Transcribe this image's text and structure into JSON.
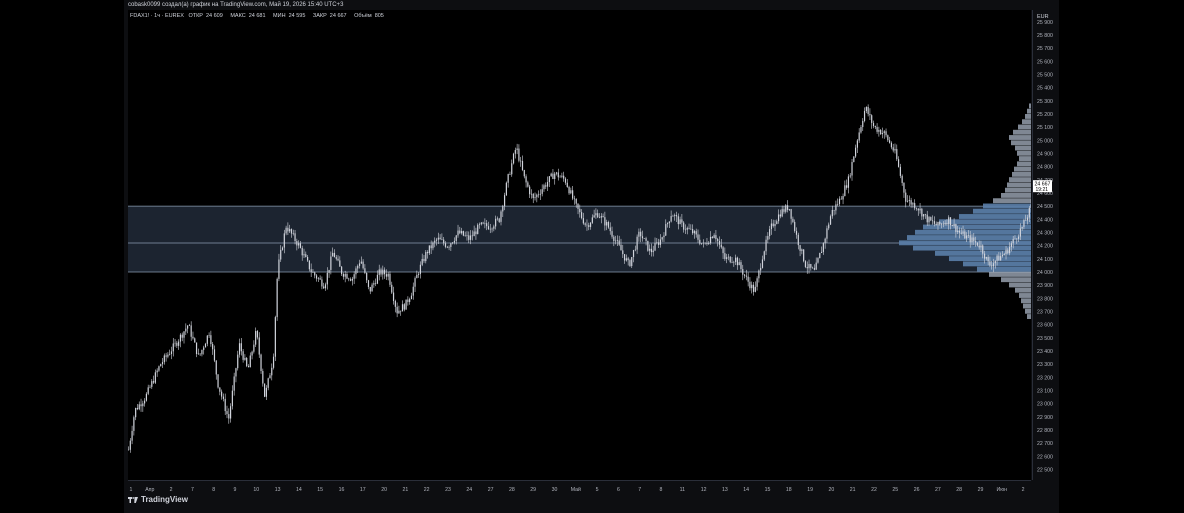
{
  "header": {
    "caption": "cobask0099 создал(а) график на TradingView.com, Май 19, 2026 15:40 UTC+3"
  },
  "legend": {
    "symbol": "FDAX1! · 1ч · EUREX",
    "open_label": "ОТКР",
    "open_value": "24 609",
    "high_label": "МАКС",
    "high_value": "24 681",
    "low_label": "МИН",
    "low_value": "24 595",
    "close_label": "ЗАКР",
    "close_value": "24 667",
    "volume_label": "Объём",
    "volume_value": "805"
  },
  "footer": {
    "brand": "TradingView"
  },
  "colors": {
    "candle": "#d1d4dc",
    "zone_fill": "#1c2430",
    "zone_line": "#8a9bb0",
    "profile": "#5b7faa",
    "profile_light": "#a9b4c4",
    "price_tag_bg": "#ffffff",
    "price_tag_text": "#000000"
  },
  "chart_data": {
    "type": "candlestick",
    "currency": "EUR",
    "y_ticks": [
      "25 900",
      "25 800",
      "25 700",
      "25 600",
      "25 500",
      "25 400",
      "25 300",
      "25 200",
      "25 100",
      "25 000",
      "24 900",
      "24 800",
      "24 700",
      "24 600",
      "24 500",
      "24 400",
      "24 300",
      "24 200",
      "24 100",
      "24 000",
      "23 900",
      "23 800",
      "23 700",
      "23 600",
      "23 500",
      "23 400",
      "23 300",
      "23 200",
      "23 100",
      "23 000",
      "22 900",
      "22 800",
      "22 700",
      "22 600",
      "22 500"
    ],
    "ylim": [
      22420,
      25990
    ],
    "x_ticks": [
      "1",
      "Апр",
      "2",
      "7",
      "8",
      "9",
      "10",
      "13",
      "14",
      "15",
      "16",
      "17",
      "20",
      "21",
      "22",
      "23",
      "24",
      "27",
      "28",
      "29",
      "30",
      "Май",
      "5",
      "6",
      "7",
      "8",
      "11",
      "12",
      "13",
      "14",
      "15",
      "18",
      "19",
      "20",
      "21",
      "22",
      "25",
      "26",
      "27",
      "28",
      "29",
      "Июн",
      "2"
    ],
    "price_tag": {
      "value": "24 667",
      "countdown": "19:21"
    },
    "value_area": {
      "high": 24500,
      "poc": 24220,
      "low": 24000
    },
    "price_path": [
      [
        0,
        22650
      ],
      [
        0.3,
        22950
      ],
      [
        0.8,
        23050
      ],
      [
        1.5,
        23300
      ],
      [
        2.2,
        23450
      ],
      [
        2.8,
        23600
      ],
      [
        3.3,
        23350
      ],
      [
        3.8,
        23550
      ],
      [
        4.2,
        23150
      ],
      [
        4.7,
        22880
      ],
      [
        5.2,
        23450
      ],
      [
        5.6,
        23250
      ],
      [
        6.0,
        23550
      ],
      [
        6.4,
        23050
      ],
      [
        6.8,
        23350
      ],
      [
        7.0,
        24020
      ],
      [
        7.4,
        24350
      ],
      [
        8.0,
        24200
      ],
      [
        8.6,
        24000
      ],
      [
        9.2,
        23900
      ],
      [
        9.6,
        24150
      ],
      [
        10.0,
        24000
      ],
      [
        10.5,
        23950
      ],
      [
        10.9,
        24100
      ],
      [
        11.3,
        23850
      ],
      [
        11.8,
        24000
      ],
      [
        12.2,
        23980
      ],
      [
        12.6,
        23700
      ],
      [
        13.0,
        23750
      ],
      [
        13.3,
        23850
      ],
      [
        13.6,
        24000
      ],
      [
        14.0,
        24150
      ],
      [
        14.5,
        24250
      ],
      [
        15.0,
        24200
      ],
      [
        15.5,
        24300
      ],
      [
        16.0,
        24250
      ],
      [
        16.5,
        24350
      ],
      [
        17.0,
        24350
      ],
      [
        17.4,
        24400
      ],
      [
        17.8,
        24700
      ],
      [
        18.2,
        24950
      ],
      [
        18.6,
        24700
      ],
      [
        19.0,
        24550
      ],
      [
        19.5,
        24650
      ],
      [
        20.0,
        24750
      ],
      [
        20.5,
        24700
      ],
      [
        21.0,
        24500
      ],
      [
        21.5,
        24350
      ],
      [
        22.0,
        24450
      ],
      [
        22.5,
        24350
      ],
      [
        23.0,
        24200
      ],
      [
        23.5,
        24050
      ],
      [
        24.0,
        24300
      ],
      [
        24.5,
        24150
      ],
      [
        25.0,
        24250
      ],
      [
        25.5,
        24450
      ],
      [
        26.0,
        24350
      ],
      [
        26.5,
        24300
      ],
      [
        27.0,
        24200
      ],
      [
        27.5,
        24300
      ],
      [
        28.0,
        24100
      ],
      [
        28.5,
        24100
      ],
      [
        29.0,
        23950
      ],
      [
        29.4,
        23850
      ],
      [
        29.8,
        24150
      ],
      [
        30.2,
        24350
      ],
      [
        30.6,
        24450
      ],
      [
        31.0,
        24500
      ],
      [
        31.4,
        24250
      ],
      [
        31.8,
        24050
      ],
      [
        32.2,
        24000
      ],
      [
        32.6,
        24200
      ],
      [
        33.0,
        24450
      ],
      [
        33.4,
        24550
      ],
      [
        33.8,
        24700
      ],
      [
        34.2,
        25000
      ],
      [
        34.6,
        25250
      ],
      [
        35.0,
        25100
      ],
      [
        35.5,
        25050
      ],
      [
        36.0,
        24900
      ],
      [
        36.5,
        24550
      ],
      [
        37.0,
        24500
      ],
      [
        37.5,
        24400
      ],
      [
        38.0,
        24350
      ],
      [
        38.5,
        24400
      ],
      [
        39.0,
        24300
      ],
      [
        39.5,
        24250
      ],
      [
        40.0,
        24200
      ],
      [
        40.4,
        24050
      ],
      [
        40.8,
        24100
      ],
      [
        41.2,
        24150
      ],
      [
        41.6,
        24250
      ],
      [
        42.0,
        24350
      ],
      [
        42.4,
        24500
      ],
      [
        42.8,
        24450
      ],
      [
        43.2,
        24300
      ],
      [
        43.6,
        24150
      ],
      [
        44.0,
        24050
      ],
      [
        44.4,
        23850
      ],
      [
        44.8,
        23750
      ],
      [
        45.2,
        24000
      ],
      [
        45.6,
        24250
      ],
      [
        46.0,
        24400
      ],
      [
        46.4,
        24300
      ],
      [
        46.8,
        24550
      ],
      [
        47.0,
        24667
      ]
    ],
    "volume_profile": [
      [
        25260,
        2
      ],
      [
        25220,
        4
      ],
      [
        25180,
        6
      ],
      [
        25140,
        9
      ],
      [
        25100,
        13
      ],
      [
        25060,
        18
      ],
      [
        25020,
        22
      ],
      [
        24980,
        20
      ],
      [
        24940,
        16
      ],
      [
        24900,
        14
      ],
      [
        24860,
        12
      ],
      [
        24820,
        14
      ],
      [
        24780,
        17
      ],
      [
        24740,
        19
      ],
      [
        24700,
        22
      ],
      [
        24660,
        24
      ],
      [
        24620,
        26
      ],
      [
        24580,
        30
      ],
      [
        24540,
        38
      ],
      [
        24500,
        48
      ],
      [
        24460,
        58
      ],
      [
        24420,
        72
      ],
      [
        24380,
        92
      ],
      [
        24340,
        108
      ],
      [
        24300,
        116
      ],
      [
        24260,
        124
      ],
      [
        24220,
        132
      ],
      [
        24180,
        118
      ],
      [
        24140,
        96
      ],
      [
        24100,
        82
      ],
      [
        24060,
        68
      ],
      [
        24020,
        54
      ],
      [
        23980,
        42
      ],
      [
        23940,
        30
      ],
      [
        23900,
        22
      ],
      [
        23860,
        16
      ],
      [
        23820,
        12
      ],
      [
        23780,
        10
      ],
      [
        23740,
        8
      ],
      [
        23700,
        6
      ],
      [
        23660,
        4
      ]
    ]
  }
}
